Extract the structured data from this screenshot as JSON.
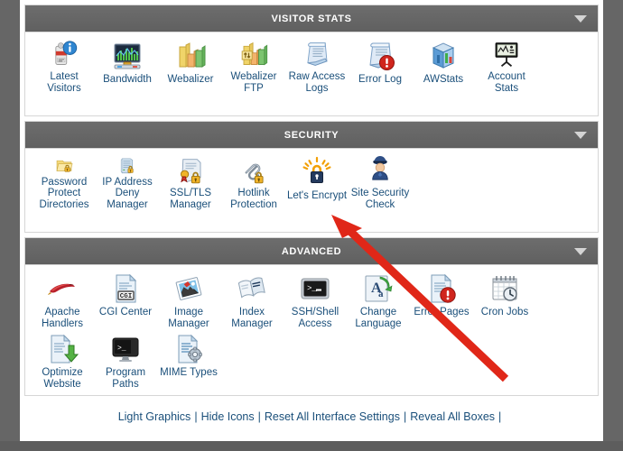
{
  "colors": {
    "header_bg": "#646464",
    "page_bg": "#666666",
    "link": "#1a4f7a",
    "panel_border": "#d6d6d6",
    "annotation_arrow": "#e02718"
  },
  "sections": [
    {
      "id": "visitor-stats",
      "title": "VISITOR STATS",
      "collapse_icon": "chevron-down-icon",
      "items": [
        {
          "label": "Latest Visitors",
          "icon": "latest-visitors-icon"
        },
        {
          "label": "Bandwidth",
          "icon": "bandwidth-icon"
        },
        {
          "label": "Webalizer",
          "icon": "webalizer-icon"
        },
        {
          "label": "Webalizer FTP",
          "icon": "webalizer-ftp-icon"
        },
        {
          "label": "Raw Access Logs",
          "icon": "raw-access-logs-icon"
        },
        {
          "label": "Error Log",
          "icon": "error-log-icon"
        },
        {
          "label": "AWStats",
          "icon": "awstats-icon"
        },
        {
          "label": "Account Stats",
          "icon": "account-stats-icon"
        }
      ]
    },
    {
      "id": "security",
      "title": "SECURITY",
      "collapse_icon": "chevron-down-icon",
      "items": [
        {
          "label": "Password Protect Directories",
          "icon": "password-protect-directories-icon"
        },
        {
          "label": "IP Address Deny Manager",
          "icon": "ip-address-deny-manager-icon"
        },
        {
          "label": "SSL/TLS Manager",
          "icon": "ssl-tls-manager-icon"
        },
        {
          "label": "Hotlink Protection",
          "icon": "hotlink-protection-icon"
        },
        {
          "label": "Let's Encrypt",
          "icon": "lets-encrypt-icon"
        },
        {
          "label": "Site Security Check",
          "icon": "site-security-check-icon"
        }
      ]
    },
    {
      "id": "advanced",
      "title": "ADVANCED",
      "collapse_icon": "chevron-down-icon",
      "items": [
        {
          "label": "Apache Handlers",
          "icon": "apache-handlers-icon"
        },
        {
          "label": "CGI Center",
          "icon": "cgi-center-icon"
        },
        {
          "label": "Image Manager",
          "icon": "image-manager-icon"
        },
        {
          "label": "Index Manager",
          "icon": "index-manager-icon"
        },
        {
          "label": "SSH/Shell Access",
          "icon": "ssh-shell-access-icon"
        },
        {
          "label": "Change Language",
          "icon": "change-language-icon"
        },
        {
          "label": "Error Pages",
          "icon": "error-pages-icon"
        },
        {
          "label": "Cron Jobs",
          "icon": "cron-jobs-icon"
        },
        {
          "label": "Optimize Website",
          "icon": "optimize-website-icon"
        },
        {
          "label": "Program Paths",
          "icon": "program-paths-icon"
        },
        {
          "label": "MIME Types",
          "icon": "mime-types-icon"
        }
      ]
    }
  ],
  "footer": {
    "links": [
      "Light Graphics",
      "Hide Icons",
      "Reset All Interface Settings",
      "Reveal All Boxes"
    ],
    "separator": "|"
  },
  "annotation": {
    "type": "arrow",
    "points_to": "Let's Encrypt",
    "color": "#e02718"
  }
}
